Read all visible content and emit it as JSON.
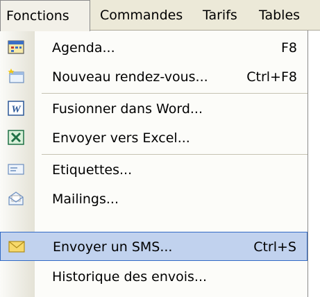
{
  "menubar": {
    "items": [
      {
        "label": "Fonctions",
        "active": true
      },
      {
        "label": "Commandes"
      },
      {
        "label": "Tarifs"
      },
      {
        "label": "Tables"
      }
    ]
  },
  "menu": {
    "items": [
      {
        "label": "Agenda...",
        "shortcut": "F8",
        "icon": "calendar-icon"
      },
      {
        "label": "Nouveau rendez-vous...",
        "shortcut": "Ctrl+F8",
        "icon": "new-appointment-icon"
      },
      {
        "label": "Fusionner dans Word...",
        "shortcut": "",
        "icon": "word-icon"
      },
      {
        "label": "Envoyer vers Excel...",
        "shortcut": "",
        "icon": "excel-icon"
      },
      {
        "label": "Etiquettes...",
        "shortcut": "",
        "icon": "label-icon"
      },
      {
        "label": "Mailings...",
        "shortcut": "",
        "icon": "mailing-icon"
      },
      {
        "label": "Envoyer un SMS...",
        "shortcut": "Ctrl+S",
        "icon": "sms-envelope-icon",
        "highlighted": true
      },
      {
        "label": "Historique des envois...",
        "shortcut": "",
        "icon": ""
      }
    ]
  }
}
